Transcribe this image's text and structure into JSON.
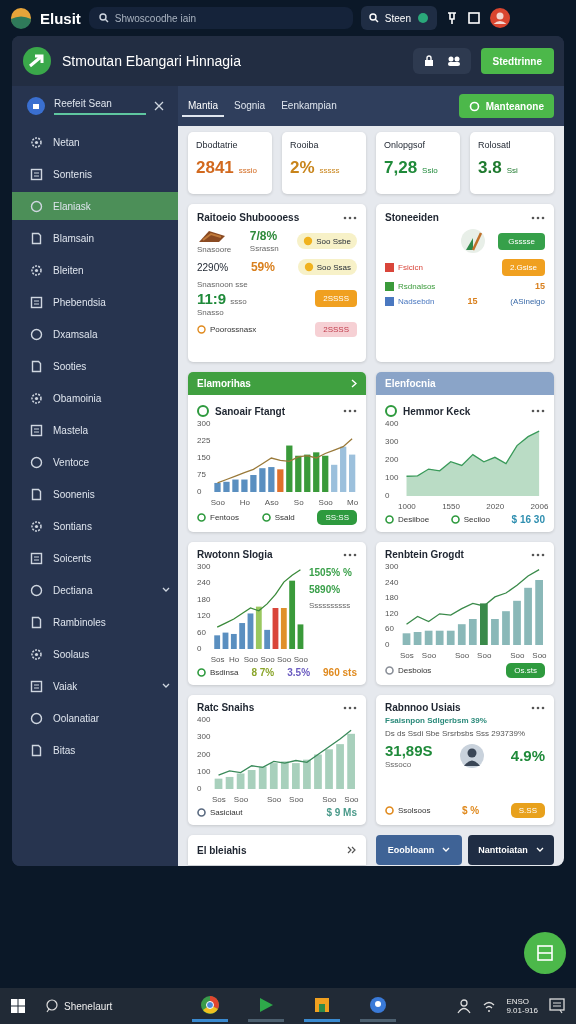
{
  "topbar": {
    "app_name": "Elusit",
    "search": {
      "placeholder": "Shwoscoodhe iain"
    },
    "search_button": "Steen"
  },
  "window": {
    "title": "Stmoutan Ebangari Hinnagia",
    "action_button": "Stedtrinne"
  },
  "sidebar": {
    "header": "Reefeit Sean",
    "items": [
      {
        "label": "Netan",
        "selected": false,
        "expandable": false
      },
      {
        "label": "Sontenis",
        "selected": false,
        "expandable": false
      },
      {
        "label": "Elaniask",
        "selected": true,
        "expandable": false
      },
      {
        "label": "Blamsain",
        "selected": false,
        "expandable": false
      },
      {
        "label": "Bleiten",
        "selected": false,
        "expandable": false
      },
      {
        "label": "Phebendsia",
        "selected": false,
        "expandable": false
      },
      {
        "label": "Dxamsala",
        "selected": false,
        "expandable": false
      },
      {
        "label": "Sooties",
        "selected": false,
        "expandable": false
      },
      {
        "label": "Obamoinia",
        "selected": false,
        "expandable": false
      },
      {
        "label": "Mastela",
        "selected": false,
        "expandable": false
      },
      {
        "label": "Ventoce",
        "selected": false,
        "expandable": false
      },
      {
        "label": "Soonenis",
        "selected": false,
        "expandable": false
      },
      {
        "label": "Sontians",
        "selected": false,
        "expandable": false
      },
      {
        "label": "Soicents",
        "selected": false,
        "expandable": false
      },
      {
        "label": "Dectiana",
        "selected": false,
        "expandable": true
      },
      {
        "label": "Rambinoles",
        "selected": false,
        "expandable": false
      },
      {
        "label": "Soolaus",
        "selected": false,
        "expandable": false
      },
      {
        "label": "Vaiak",
        "selected": false,
        "expandable": true
      },
      {
        "label": "Oolanatiar",
        "selected": false,
        "expandable": false
      },
      {
        "label": "Bitas",
        "selected": false,
        "expandable": false
      }
    ]
  },
  "tabs": [
    {
      "label": "Mantia",
      "selected": true
    },
    {
      "label": "Sognia",
      "selected": false
    },
    {
      "label": "Eenkampian",
      "selected": false
    }
  ],
  "tab_action": "Manteanone",
  "stats": [
    {
      "title": "Dbodtatrie",
      "value": "2841",
      "note": "sssio",
      "color": "#d2691e"
    },
    {
      "title": "Rooiba",
      "value": "2%",
      "note": "sssss",
      "color": "#c8841a"
    },
    {
      "title": "Onlopgsof",
      "value": "7,28",
      "note": "Ssio",
      "color": "#1f8a3a"
    },
    {
      "title": "Rolosatl",
      "value": "3.8",
      "note": "Ssi",
      "color": "#1f7a2f"
    }
  ],
  "summary_card": {
    "title": "Raitoeio Shuboooess",
    "image_caption": "Snasoore",
    "rate": "7/8%",
    "rate_caption": "Ssrassn",
    "rate_badge": "Soo Ssbe",
    "share": "2290%",
    "share_rate": "59%",
    "share_badge": "Soo Ssas",
    "total_caption": "Snasnoon sse",
    "total": "11:9",
    "total_unit": "ssso",
    "total_sub": "Snasso",
    "total_pill": "2SSSS",
    "footer_label": "Poorossnasx",
    "footer_pill": "2SSSS"
  },
  "status_card": {
    "title": "Stoneeiden",
    "top_pill": "Gsssse",
    "rows": [
      {
        "kind": "pill",
        "label": "Fsicicn",
        "color": "#d9453a",
        "action": "2.Gsise"
      },
      {
        "kind": "value",
        "label": "Rsdnalsos",
        "color": "#3a9a3a",
        "value": "15"
      },
      {
        "kind": "link",
        "label": "Nadsebdn",
        "color": "#4a78c0",
        "value": "15",
        "action": "(ASineigo"
      }
    ]
  },
  "chart_cards": [
    {
      "kind": "chart",
      "header": "Elamorihas",
      "color": "#40a040",
      "title": "Sanoair Ftangt",
      "chart_data": {
        "type": "bar",
        "categories": [
          "Soo",
          null,
          null,
          "Ho",
          null,
          null,
          "Aso",
          null,
          null,
          "So",
          null,
          null,
          "Soo",
          null,
          null,
          "Mo"
        ],
        "ylim": [
          0,
          300
        ],
        "yticks": [
          0,
          75,
          150,
          225,
          300
        ],
        "series": [
          {
            "color": "#5a8fc0",
            "values": [
              40,
              45,
              55,
              55,
              75,
              105,
              110,
              null,
              null,
              null,
              null,
              null,
              null,
              null,
              null,
              null
            ]
          },
          {
            "color": "#e0702a",
            "values": [
              null,
              null,
              null,
              null,
              null,
              null,
              null,
              100,
              null,
              null,
              null,
              null,
              null,
              null,
              null,
              null
            ]
          },
          {
            "color": "#3a9a3a",
            "values": [
              null,
              null,
              null,
              null,
              null,
              null,
              null,
              null,
              205,
              160,
              165,
              175,
              160,
              null,
              null,
              null
            ]
          },
          {
            "color": "#9cc0dc",
            "values": [
              null,
              null,
              null,
              null,
              null,
              null,
              null,
              null,
              null,
              null,
              null,
              null,
              null,
              120,
              200,
              165
            ]
          },
          {
            "type": "line",
            "color": "#9a7a3a",
            "values": [
              40,
              55,
              70,
              85,
              100,
              125,
              150,
              140,
              135,
              155,
              160,
              150,
              170,
              185,
              200,
              235
            ]
          }
        ]
      },
      "footer": [
        {
          "kind": "legend",
          "text": "Fentoos",
          "color": "#2e9a3e"
        },
        {
          "kind": "legend",
          "text": "Ssald",
          "color": "#2e9a3e"
        },
        {
          "kind": "pill",
          "text": "SS:SS",
          "color": "#2e9a3e"
        }
      ]
    },
    {
      "kind": "chart",
      "header": "Elenfocnia",
      "color": "#8aa4c8",
      "title": "Hemmor Keck",
      "chart_data": {
        "type": "area",
        "categories": [
          "1000",
          null,
          null,
          null,
          "1550",
          null,
          null,
          null,
          "2020",
          null,
          null,
          null,
          "2006"
        ],
        "ylim": [
          0,
          400
        ],
        "yticks": [
          0,
          100,
          200,
          300,
          400
        ],
        "series": [
          {
            "color": "#3a9a5a",
            "values": [
              110,
              112,
              150,
              140,
              190,
              170,
              230,
              190,
              215,
              180,
              280,
              330,
              360
            ]
          }
        ]
      },
      "footer": [
        {
          "kind": "legend",
          "text": "Desiiboe",
          "color": "#2e9a3e"
        },
        {
          "kind": "legend",
          "text": "Seciioo",
          "color": "#2e9a3e"
        },
        {
          "kind": "value",
          "text": "$ 16 30",
          "color": "#2f8fb0"
        }
      ]
    },
    {
      "kind": "chart",
      "title": "Rwotonn Slogia",
      "side_values": [
        "1505% %",
        "5890%"
      ],
      "side_caption": "Ssssssssss",
      "chart_data": {
        "type": "bar",
        "categories": [
          "Sos",
          null,
          "Ho",
          null,
          "Soo",
          null,
          "Soo",
          null,
          "Soo",
          null,
          "Soo"
        ],
        "ylim": [
          0,
          300
        ],
        "yticks": [
          0,
          60,
          120,
          180,
          240,
          300
        ],
        "series": [
          {
            "color": "#5a8fc0",
            "values": [
              50,
              60,
              55,
              95,
              130,
              null,
              70,
              null,
              null,
              null,
              null
            ]
          },
          {
            "color": "#9ac860",
            "values": [
              null,
              null,
              null,
              null,
              null,
              155,
              null,
              null,
              null,
              null,
              null
            ]
          },
          {
            "color": "#d9453a",
            "values": [
              null,
              null,
              null,
              null,
              null,
              null,
              null,
              150,
              null,
              null,
              null
            ]
          },
          {
            "color": "#e0902a",
            "values": [
              null,
              null,
              null,
              null,
              null,
              null,
              null,
              null,
              150,
              null,
              null
            ]
          },
          {
            "color": "#3a9a3a",
            "values": [
              null,
              null,
              null,
              null,
              null,
              null,
              null,
              null,
              null,
              250,
              90
            ]
          },
          {
            "type": "line",
            "color": "#3a8a3a",
            "values": [
              80,
              95,
              110,
              130,
              150,
              140,
              165,
              200,
              245,
              270,
              290
            ]
          }
        ]
      },
      "footer": [
        {
          "kind": "legend",
          "text": "Bsdinsa",
          "color": "#2e9a3e"
        },
        {
          "kind": "value",
          "text": "8 7%",
          "color": "#8aa52a"
        },
        {
          "kind": "value",
          "text": "3.5%",
          "color": "#6a5bc0"
        },
        {
          "kind": "value",
          "text": "960 sts",
          "color": "#e08a1e"
        }
      ]
    },
    {
      "kind": "chart",
      "title": "Renbtein Grogdt",
      "chart_data": {
        "type": "bar",
        "categories": [
          "Sos",
          null,
          "Soo",
          null,
          null,
          "Soo",
          null,
          "Soo",
          null,
          null,
          "Soo",
          null,
          "Soo"
        ],
        "ylim": [
          0,
          300
        ],
        "yticks": [
          0,
          60,
          120,
          180,
          240,
          300
        ],
        "series": [
          {
            "color": "#8ab8b8",
            "values": [
              45,
              50,
              55,
              55,
              55,
              80,
              100,
              null,
              100,
              130,
              170,
              220,
              250
            ]
          },
          {
            "color": "#3a8a4a",
            "values": [
              null,
              null,
              null,
              null,
              null,
              null,
              null,
              160,
              null,
              null,
              null,
              null,
              null
            ]
          },
          {
            "type": "line",
            "color": "#3a8a4a",
            "values": [
              80,
              110,
              90,
              120,
              115,
              140,
              160,
              150,
              185,
              200,
              230,
              265,
              290
            ]
          }
        ]
      },
      "footer": [
        {
          "kind": "legend",
          "text": "Desboios",
          "color": "#8a8f98"
        },
        {
          "kind": "pill",
          "text": "Os.sts",
          "color": "#2e9a3e"
        }
      ]
    },
    {
      "kind": "chart",
      "title": "Ratc Snaihs",
      "chart_data": {
        "type": "bar",
        "categories": [
          "Sos",
          null,
          "Soo",
          null,
          null,
          "Soo",
          null,
          "Soo",
          null,
          null,
          "Soo",
          null,
          "Soo"
        ],
        "ylim": [
          0,
          400
        ],
        "yticks": [
          0,
          100,
          200,
          300,
          400
        ],
        "series": [
          {
            "color": "#a8d0bc",
            "values": [
              60,
              70,
              90,
              110,
              130,
              150,
              160,
              150,
              170,
              200,
              230,
              260,
              320
            ]
          },
          {
            "type": "line",
            "color": "#3a8a5a",
            "values": [
              80,
              105,
              95,
              135,
              125,
              160,
              150,
              165,
              155,
              200,
              245,
              290,
              340
            ]
          }
        ]
      },
      "footer": [
        {
          "kind": "legend",
          "text": "Sasiciaut",
          "color": "#5a6a80"
        },
        {
          "kind": "value",
          "text": "$ 9 Ms",
          "color": "#4a9a8a"
        }
      ]
    },
    {
      "kind": "balance",
      "title": "Rabnnoo Usiais",
      "lines": [
        "Fsaisnpon Sdlgerbsm 39%",
        "Ds ds Ssdi Sbe Srsrbsbs Sss 293739%"
      ],
      "amount": "31,89S",
      "amount_caption": "Sssoco",
      "rate": "4.9%",
      "footer": [
        {
          "kind": "legend",
          "text": "Ssolsoos",
          "color": "#e08a1e"
        },
        {
          "kind": "value",
          "text": "$ %",
          "color": "#e08a1e"
        },
        {
          "kind": "pill",
          "text": "S.SS",
          "color": "#e8a11c"
        }
      ]
    }
  ],
  "bottom_card": {
    "title": "El bleiahis"
  },
  "dropdowns": [
    {
      "label": "Eoobloann",
      "selected": true
    },
    {
      "label": "Nanttoiatan",
      "selected": false
    }
  ],
  "taskbar": {
    "search": "Shenelaurt",
    "apps": [
      {
        "active": true
      },
      {
        "active": false
      },
      {
        "active": true
      },
      {
        "active": false
      }
    ],
    "time": "ENSO",
    "date": "9.01-916"
  }
}
